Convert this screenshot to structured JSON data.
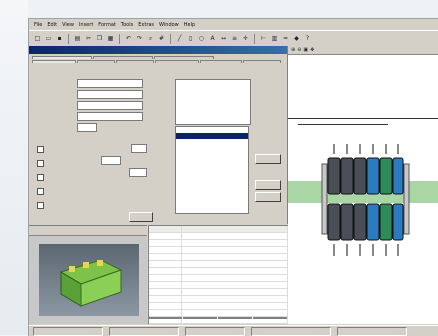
{
  "menubar": {
    "items": [
      "File",
      "Edit",
      "View",
      "Insert",
      "Format",
      "Tools",
      "Extras",
      "Window",
      "Help"
    ]
  },
  "toolbar": {
    "icons": [
      "new-icon",
      "open-icon",
      "save-icon",
      "print-icon",
      "cut-icon",
      "copy-icon",
      "paste-icon",
      "undo-icon",
      "redo-icon",
      "zoom-icon",
      "grid-icon",
      "line-icon",
      "rect-icon",
      "circle-icon",
      "text-icon",
      "dimension-icon",
      "layer-icon",
      "snap-icon",
      "measure-icon",
      "terminal-icon",
      "rail-icon",
      "marker-icon",
      "help-icon"
    ]
  },
  "dialog": {
    "title": "",
    "tabs_row1": [
      "",
      "",
      ""
    ],
    "tabs_row2": [
      "",
      "",
      "",
      "",
      "",
      ""
    ],
    "form_labels": [
      "",
      "",
      "",
      "",
      ""
    ],
    "form_values": [
      "",
      "",
      "",
      "",
      ""
    ],
    "tree_items": [
      "",
      "",
      "",
      "",
      "",
      "",
      ""
    ],
    "list_items": [
      "",
      "",
      "",
      "",
      "",
      "",
      "",
      "",
      "",
      "",
      "",
      ""
    ],
    "button_labels": [
      "",
      "",
      "",
      ""
    ]
  },
  "preview": {
    "header": ""
  },
  "table": {
    "headers": [
      "",
      ""
    ],
    "rows": 14
  },
  "bottom_tabs": [
    "",
    "",
    "",
    ""
  ],
  "statusbar": {
    "segments": [
      "",
      "",
      "",
      "",
      ""
    ]
  },
  "colors": {
    "rail": "#a9d6a4",
    "terminal_green": "#2e8b57",
    "terminal_blue": "#2a7bc0",
    "terminal_gray": "#4a4f57",
    "title_bar": "#0a246a"
  }
}
